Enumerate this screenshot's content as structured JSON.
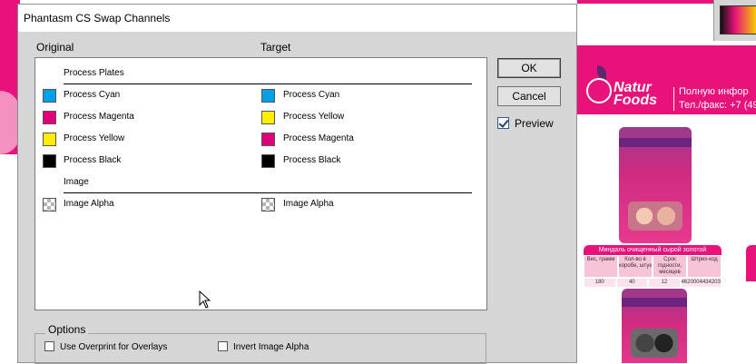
{
  "dialog": {
    "title": "Phantasm CS Swap Channels",
    "original_header": "Original",
    "target_header": "Target",
    "groups": [
      {
        "label": "Process Plates",
        "rows": [
          {
            "original": "Process Cyan",
            "original_color": "#00a0e6",
            "target": "Process Cyan",
            "target_color": "#00a0e6"
          },
          {
            "original": "Process Magenta",
            "original_color": "#e0007a",
            "target": "Process Yellow",
            "target_color": "#ffee00"
          },
          {
            "original": "Process Yellow",
            "original_color": "#ffee00",
            "target": "Process Magenta",
            "target_color": "#e0007a"
          },
          {
            "original": "Process Black",
            "original_color": "#000000",
            "target": "Process Black",
            "target_color": "#000000"
          }
        ]
      },
      {
        "label": "Image",
        "rows": [
          {
            "original": "Image Alpha",
            "original_color": "transparent",
            "target": "Image Alpha",
            "target_color": "transparent"
          }
        ]
      }
    ],
    "buttons": {
      "ok": "OK",
      "cancel": "Cancel"
    },
    "preview": {
      "label": "Preview",
      "checked": true
    },
    "options": {
      "legend": "Options",
      "overprint": {
        "label": "Use Overprint for Overlays",
        "checked": false
      },
      "invert_alpha": {
        "label": "Invert Image Alpha",
        "checked": false
      }
    }
  },
  "background": {
    "logo_line1": "Natur",
    "logo_line2": "Foods",
    "contact_line1": "Полную инфор",
    "contact_line2": "Тел./факс: +7 (49",
    "product_title": "Миндаль очищенный сырой золотой",
    "table_headers": [
      "Вес, грамм",
      "Кол-во в коробе, штук",
      "Срок годности, месяцев",
      "Штрих-код"
    ],
    "table_values": [
      "180",
      "40",
      "12",
      "4620004434203"
    ],
    "brand_color": "#e8127a"
  }
}
